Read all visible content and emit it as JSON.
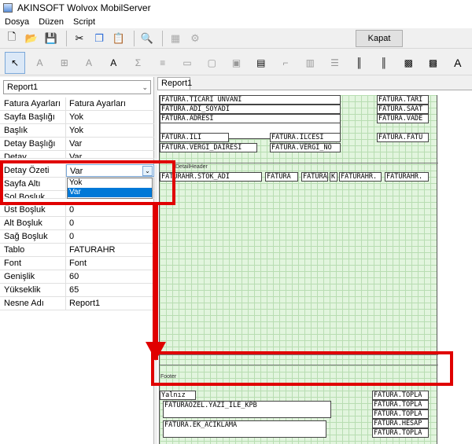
{
  "window": {
    "title": "AKINSOFT Wolvox MobilServer"
  },
  "menu": {
    "items": [
      "Dosya",
      "Düzen",
      "Script"
    ]
  },
  "toolbar": {
    "close_label": "Kapat"
  },
  "left_panel": {
    "report_select": "Report1",
    "properties": [
      {
        "key": "Fatura Ayarları",
        "value": "Fatura Ayarları"
      },
      {
        "key": "Sayfa Başlığı",
        "value": "Yok"
      },
      {
        "key": "Başlık",
        "value": "Yok"
      },
      {
        "key": "Detay Başlığı",
        "value": "Var"
      },
      {
        "key": "Detay",
        "value": "Var"
      },
      {
        "key": "Detay Özeti",
        "value": "Var"
      },
      {
        "key": "Sayfa Altı",
        "value": ""
      },
      {
        "key": "Sol Boşluk",
        "value": ""
      },
      {
        "key": "Üst Boşluk",
        "value": "0"
      },
      {
        "key": "Alt Boşluk",
        "value": "0"
      },
      {
        "key": "Sağ Boşluk",
        "value": "0"
      },
      {
        "key": "Tablo",
        "value": "FATURAHR"
      },
      {
        "key": "Font",
        "value": "Font"
      },
      {
        "key": "Genişlik",
        "value": "60"
      },
      {
        "key": "Yükseklik",
        "value": "65"
      },
      {
        "key": "Nesne Adı",
        "value": "Report1"
      }
    ],
    "dropdown_options": [
      "Yok",
      "Var"
    ]
  },
  "designer": {
    "tab_label": "Report1",
    "fields": {
      "ticari_unvani": "FATURA.TICARI UNVANI",
      "adi_soyadi": "FATURA.ADI_SOYADI",
      "adresi": "FATURA.ADRESI",
      "ili": "FATURA.ILI",
      "ilcesi": "FATURA.ILCESI",
      "vergi_dairesi": "FATURA.VERGI_DAIRESI",
      "vergi_no": "FATURA.VERGI_NO",
      "tari": "FATURA.TARI",
      "saat": "FATURA.SAAT",
      "vade": "FATURA.VADE",
      "fatu": "FATURA.FATU",
      "stok_adi": "FATURAHR.STOK_ADI",
      "col2": "FATURA",
      "col3": "FATURA",
      "col4": "K",
      "col5": "FATURAHR.",
      "col6": "FATURAHR.",
      "yalniz": "Yalnız",
      "yazi_ile": "FATURAOZEL.YAZI_ILE_KPB",
      "ek_aciklama": "FATURA.EK_ACIKLAMA",
      "topla1": "FATURA.TOPLA",
      "topla2": "FATURA.TOPLA",
      "topla3": "FATURA.TOPLA",
      "hesap": "FATURA.HESAP",
      "topla4": "FATURA.TOPLA"
    },
    "bands": {
      "detail_header": "DetailHeader",
      "footer": "Footer"
    }
  }
}
